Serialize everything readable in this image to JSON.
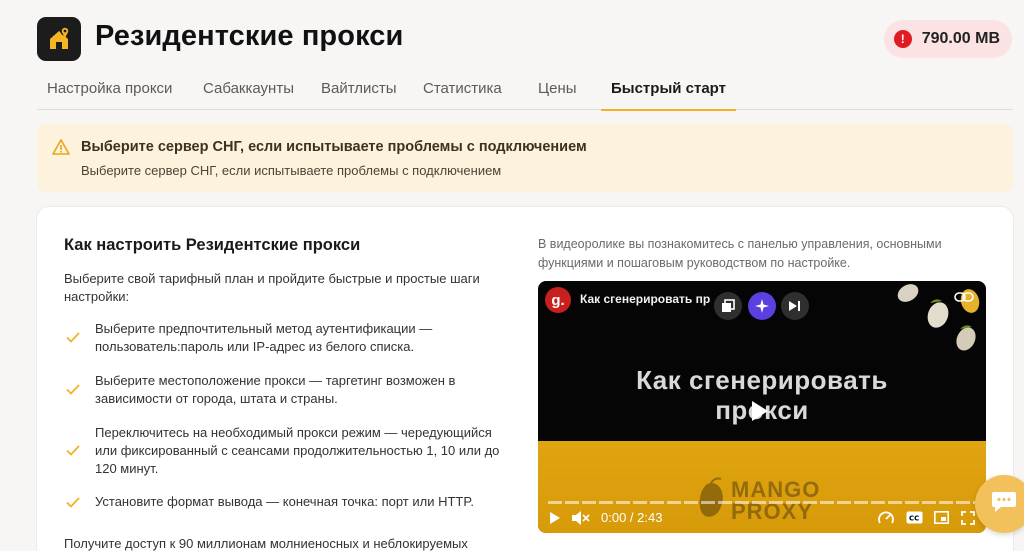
{
  "header": {
    "title": "Резидентские прокси",
    "logo_icon": "home-location-icon",
    "balance": "790.00 MB",
    "balance_alert": "!",
    "balance_color": "#e01b24"
  },
  "tabs": [
    {
      "label": "Настройка прокси"
    },
    {
      "label": "Сабаккаунты"
    },
    {
      "label": "Вайтлисты"
    },
    {
      "label": "Статистика"
    },
    {
      "label": "Цены"
    },
    {
      "label": "Быстрый старт",
      "active": true
    }
  ],
  "warning": {
    "title": "Выберите сервер СНГ, если испытываете проблемы с подключением",
    "subtitle": "Выберите сервер СНГ, если испытываете проблемы с подключением",
    "icon": "warning-icon"
  },
  "guide": {
    "title": "Как настроить Резидентские прокси",
    "intro": "Выберите свой тарифный план и пройдите быстрые и простые шаги настройки:",
    "steps": [
      "Выберите предпочтительный метод аутентификации — пользователь:пароль или IP-адрес из белого списка.",
      "Выберите местоположение прокси — таргетинг возможен в зависимости от города, штата и страны.",
      "Переключитесь на необходимый прокси режим — чередующийся или фиксированный с сеансами продолжительностью 1, 10 или до 120 минут.",
      "Установите формат вывода — конечная точка: порт или HTTP."
    ],
    "footer": "Получите доступ к 90 миллионам молниеносных и неблокируемых"
  },
  "video": {
    "description": "В видеоролике вы познакомитесь с панелью управления, основными функциями и пошаговым руководством по настройке.",
    "channel_logo": "g.",
    "title": "Как сгенерировать пр",
    "headline_line1": "Как сгенерировать",
    "headline_line2": "прокси",
    "watermark_line1": "MANGO",
    "watermark_line2": "PROXY",
    "time": "0:00 / 2:43"
  },
  "accent_color": "#f0b323"
}
